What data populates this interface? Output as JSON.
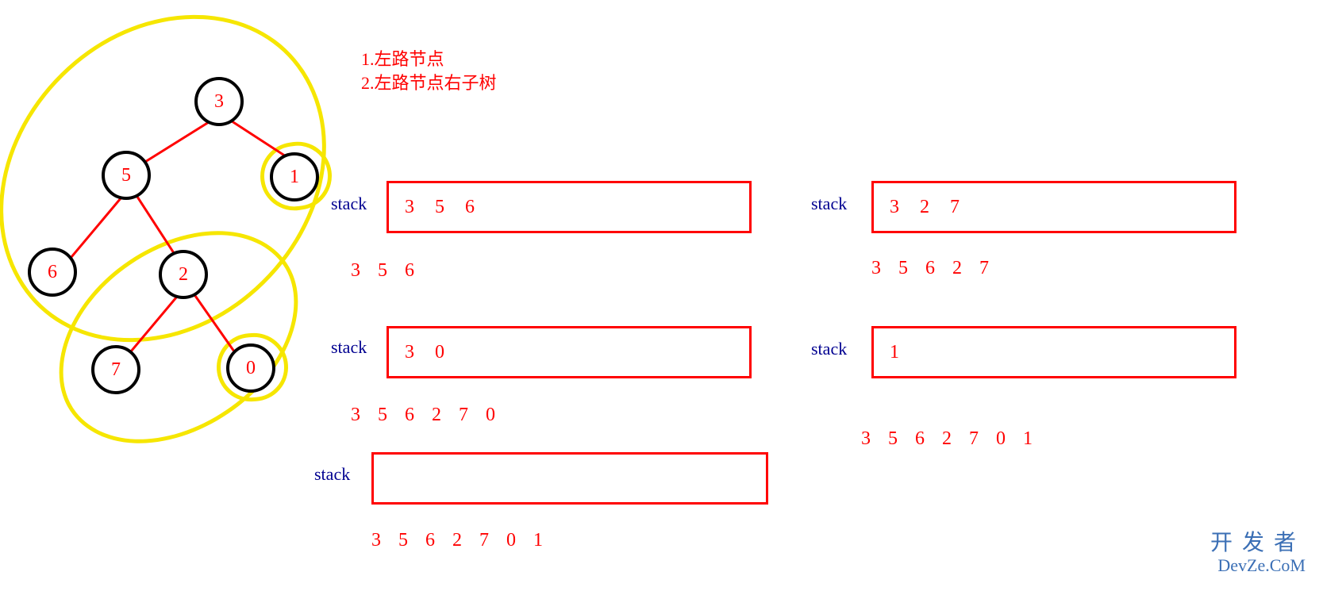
{
  "notes": {
    "line1": "1.左路节点",
    "line2": "2.左路节点右子树"
  },
  "tree": {
    "nodes": {
      "n3": "3",
      "n5": "5",
      "n1": "1",
      "n6": "6",
      "n2": "2",
      "n7": "7",
      "n0": "0"
    }
  },
  "labels": {
    "stack": "stack"
  },
  "stacks": {
    "left1": {
      "content": "3 5  6",
      "output": "3  5  6"
    },
    "left2": {
      "content": "3 0",
      "output": "3 5 6 2 7 0"
    },
    "left3": {
      "content": "",
      "output": "3 5 6 2 7 0 1"
    },
    "right1": {
      "content": "3 2 7",
      "output": "3 5 6 2 7"
    },
    "right2": {
      "content": "1",
      "output": "3 5 6 2 7 0 1"
    }
  },
  "watermark": {
    "line1": "开发者",
    "line2": "DevZe.CoM"
  }
}
